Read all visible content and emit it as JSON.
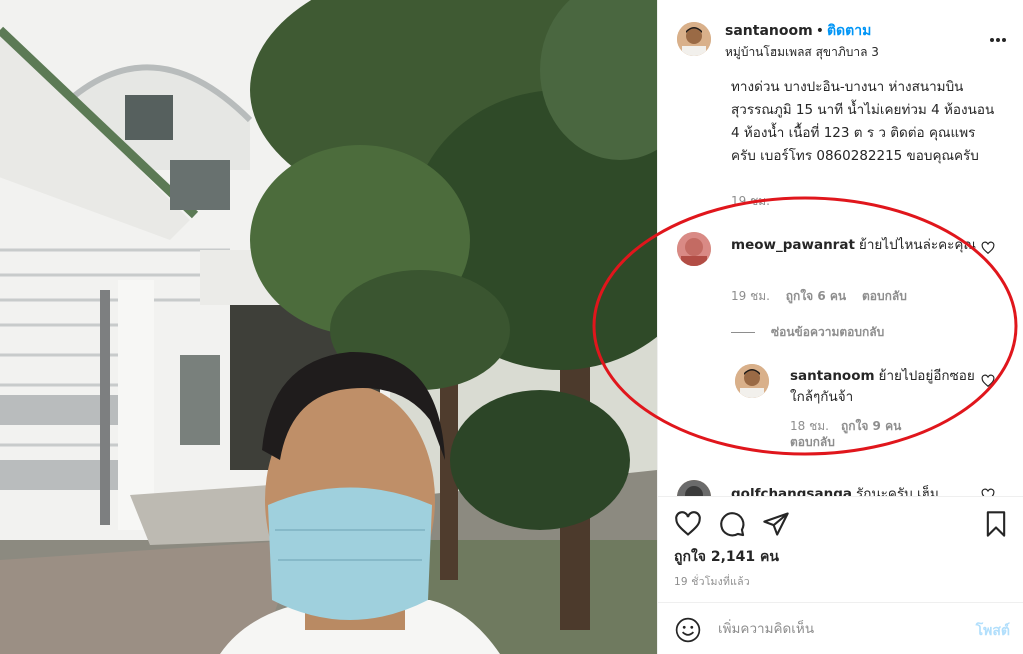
{
  "post": {
    "username": "santanoom",
    "dot": "•",
    "follow_label": "ติดตาม",
    "location": "หมู่บ้านโฮมเพลส สุขาภิบาล 3",
    "caption": "ทางด่วน บางปะอิน-บางนา ห่างสนามบินสุวรรณภูมิ 15 นาที น้ำไม่เคยท่วม 4 ห้องนอน 4 ห้องน้ำ เนื้อที่ 123 ต ร ว ติดต่อ คุณแพร ครับ เบอร์โทร 0860282215 ขอบคุณครับ",
    "caption_time": "19 ชม."
  },
  "comments": [
    {
      "username": "meow_pawanrat",
      "text": "ย้ายไปไหนล่ะคะคุณ",
      "time": "19 ชม.",
      "likes": "ถูกใจ 6 คน",
      "reply_label": "ตอบกลับ"
    },
    {
      "username": "santanoom",
      "text": "ย้ายไปอยู่อีกซอยใกล้ๆกันจ้า",
      "time": "18 ชม.",
      "likes": "ถูกใจ 9 คน",
      "reply_label": "ตอบกลับ"
    },
    {
      "username": "golfchangsanga",
      "text": "รักนะครับ เฮ็ม"
    }
  ],
  "hide_replies_label": "ซ่อนข้อความตอบกลับ",
  "likes_total": "ถูกใจ 2,141 คน",
  "posted_ago": "19 ชั่วโมงที่แล้ว",
  "add_comment": {
    "placeholder": "เพิ่มความคิดเห็น",
    "post_label": "โพสต์"
  },
  "icons": {
    "like": "heart-icon",
    "comment": "comment-icon",
    "share": "share-icon",
    "save": "bookmark-icon",
    "more": "more-icon",
    "emoji": "emoji-icon"
  },
  "colors": {
    "link": "#0095f6",
    "annotation": "#e0161c",
    "muted": "#8e8e8e",
    "post_disabled": "#b2dffc"
  }
}
